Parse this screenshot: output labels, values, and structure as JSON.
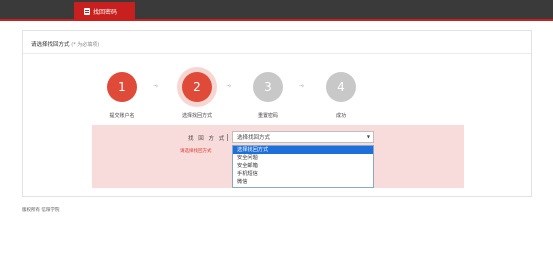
{
  "tab": {
    "label": "找回密码"
  },
  "panel": {
    "title": "请选择找回方式",
    "note": "(* 为必填项)"
  },
  "steps": [
    {
      "number": "1",
      "label": "提交账户名"
    },
    {
      "number": "2",
      "label": "选择找回方式"
    },
    {
      "number": "3",
      "label": "重置密码"
    },
    {
      "number": "4",
      "label": "成功"
    }
  ],
  "form": {
    "label": "找 回 方 式",
    "selected": "选择找回方式",
    "error": "请选择找回方式",
    "options": [
      "选择找回方式",
      "安全问题",
      "安全邮箱",
      "手机短信",
      "微信"
    ]
  },
  "footer": {
    "text": "版权所有 信阳学院"
  },
  "colors": {
    "brand": "#c8201e",
    "step_active": "#e04a38",
    "step_pending": "#c8c8c8",
    "highlight": "#1e6fd9"
  }
}
